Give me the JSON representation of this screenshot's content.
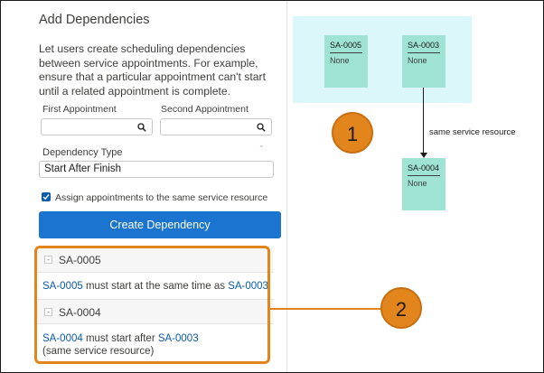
{
  "panel": {
    "title": "Add Dependencies",
    "description": "Let users create scheduling dependencies between service appointments. For example, ensure that a particular appointment can't start until a related appointment is complete.",
    "first_appointment_label": "First Appointment",
    "second_appointment_label": "Second Appointment",
    "first_appointment_value": "",
    "second_appointment_value": "",
    "dependency_type_label": "Dependency Type",
    "dependency_type_value": "Start After Finish",
    "same_resource_checked": true,
    "same_resource_label": "Assign appointments to the same service resource",
    "create_button_label": "Create Dependency"
  },
  "dependency_list": [
    {
      "header": "SA-0005",
      "toggle": "-",
      "lines": [
        {
          "link_a": "SA-0005",
          "text": " must start at the same time as ",
          "link_b": "SA-0003"
        }
      ],
      "note": ""
    },
    {
      "header": "SA-0004",
      "toggle": "-",
      "lines": [
        {
          "link_a": "SA-0004",
          "text": " must start after ",
          "link_b": "SA-0003"
        }
      ],
      "note": "(same service resource)"
    }
  ],
  "diagram": {
    "cards": [
      {
        "id": "SA-0005",
        "value": "None"
      },
      {
        "id": "SA-0003",
        "value": "None"
      },
      {
        "id": "SA-0004",
        "value": "None"
      }
    ],
    "arrow_label": "same service resource"
  },
  "callouts": [
    "1",
    "2"
  ],
  "colors": {
    "accent_orange": "#e2851d",
    "button_blue": "#1b75d0",
    "link_blue": "#0b5cab",
    "card_green": "#9ee3d4",
    "highlight_cyan": "#dcf7f9"
  },
  "icons": {
    "search": "search-icon",
    "chevron": "chevron-down-icon",
    "checkbox": "checkbox-checked-icon"
  }
}
